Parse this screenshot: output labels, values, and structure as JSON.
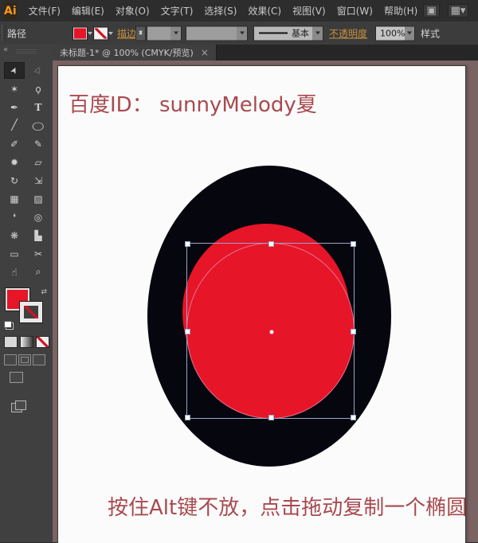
{
  "app": {
    "logo_label": "Ai"
  },
  "menu_bar": {
    "items": [
      {
        "id": "file",
        "label": "文件(F)"
      },
      {
        "id": "edit",
        "label": "编辑(E)"
      },
      {
        "id": "object",
        "label": "对象(O)"
      },
      {
        "id": "type",
        "label": "文字(T)"
      },
      {
        "id": "select",
        "label": "选择(S)"
      },
      {
        "id": "effect",
        "label": "效果(C)"
      },
      {
        "id": "view",
        "label": "视图(V)"
      },
      {
        "id": "window",
        "label": "窗口(W)"
      },
      {
        "id": "help",
        "label": "帮助(H)"
      }
    ],
    "bridge_icon_glyph": "▣",
    "arrange_documents_icon_glyph": "▦▾"
  },
  "control_bar": {
    "selection_type_label": "路径",
    "stroke_label": "描边",
    "stepper_up_glyph": "▲",
    "stepper_down_glyph": "▼",
    "brush_definition_value": "基本",
    "opacity_label": "不透明度",
    "opacity_value": "100%",
    "style_label": "样式"
  },
  "document_tab": {
    "title": "未标题-1* @ 100% (CMYK/预览)",
    "close_glyph": "×"
  },
  "toolbar": {
    "collapse_glyph": "«",
    "tools": [
      {
        "name": "selection-tool",
        "glyph": "➤"
      },
      {
        "name": "direct-selection-tool",
        "glyph": "➤"
      },
      {
        "name": "magic-wand-tool",
        "glyph": "✶"
      },
      {
        "name": "lasso-tool",
        "glyph": "ϙ"
      },
      {
        "name": "pen-tool",
        "glyph": "✒"
      },
      {
        "name": "type-tool",
        "glyph": "T"
      },
      {
        "name": "line-segment-tool",
        "glyph": "╱"
      },
      {
        "name": "ellipse-tool",
        "glyph": "◯"
      },
      {
        "name": "paintbrush-tool",
        "glyph": "✐"
      },
      {
        "name": "pencil-tool",
        "glyph": "✎"
      },
      {
        "name": "blob-brush-tool",
        "glyph": "✹"
      },
      {
        "name": "eraser-tool",
        "glyph": "▱"
      },
      {
        "name": "rotate-tool",
        "glyph": "↻"
      },
      {
        "name": "scale-tool",
        "glyph": "⇲"
      },
      {
        "name": "mesh-tool",
        "glyph": "▦"
      },
      {
        "name": "gradient-tool",
        "glyph": "▨"
      },
      {
        "name": "eyedropper-tool",
        "glyph": "❛"
      },
      {
        "name": "blend-tool",
        "glyph": "◎"
      },
      {
        "name": "symbol-sprayer-tool",
        "glyph": "❋"
      },
      {
        "name": "column-graph-tool",
        "glyph": "▙"
      },
      {
        "name": "artboard-tool",
        "glyph": "▭"
      },
      {
        "name": "slice-tool",
        "glyph": "✂"
      },
      {
        "name": "hand-tool",
        "glyph": "☝"
      },
      {
        "name": "zoom-tool",
        "glyph": "⌕"
      }
    ],
    "swap_fill_stroke_glyph": "⇄"
  },
  "canvas": {
    "top_text": "百度ID： sunnyMelody夏",
    "bottom_text": "按住Alt键不放，点击拖动复制一个椭圆",
    "colors": {
      "pasteboard": "#7a6363",
      "artboard": "#fbfbfb",
      "black_shape": "#06060e",
      "red_shape": "#e61528",
      "selection": "#9aa6cc",
      "path_highlight": "#e86f90",
      "canvas_text": "#a84a4f",
      "accent": "#c7913f"
    }
  }
}
